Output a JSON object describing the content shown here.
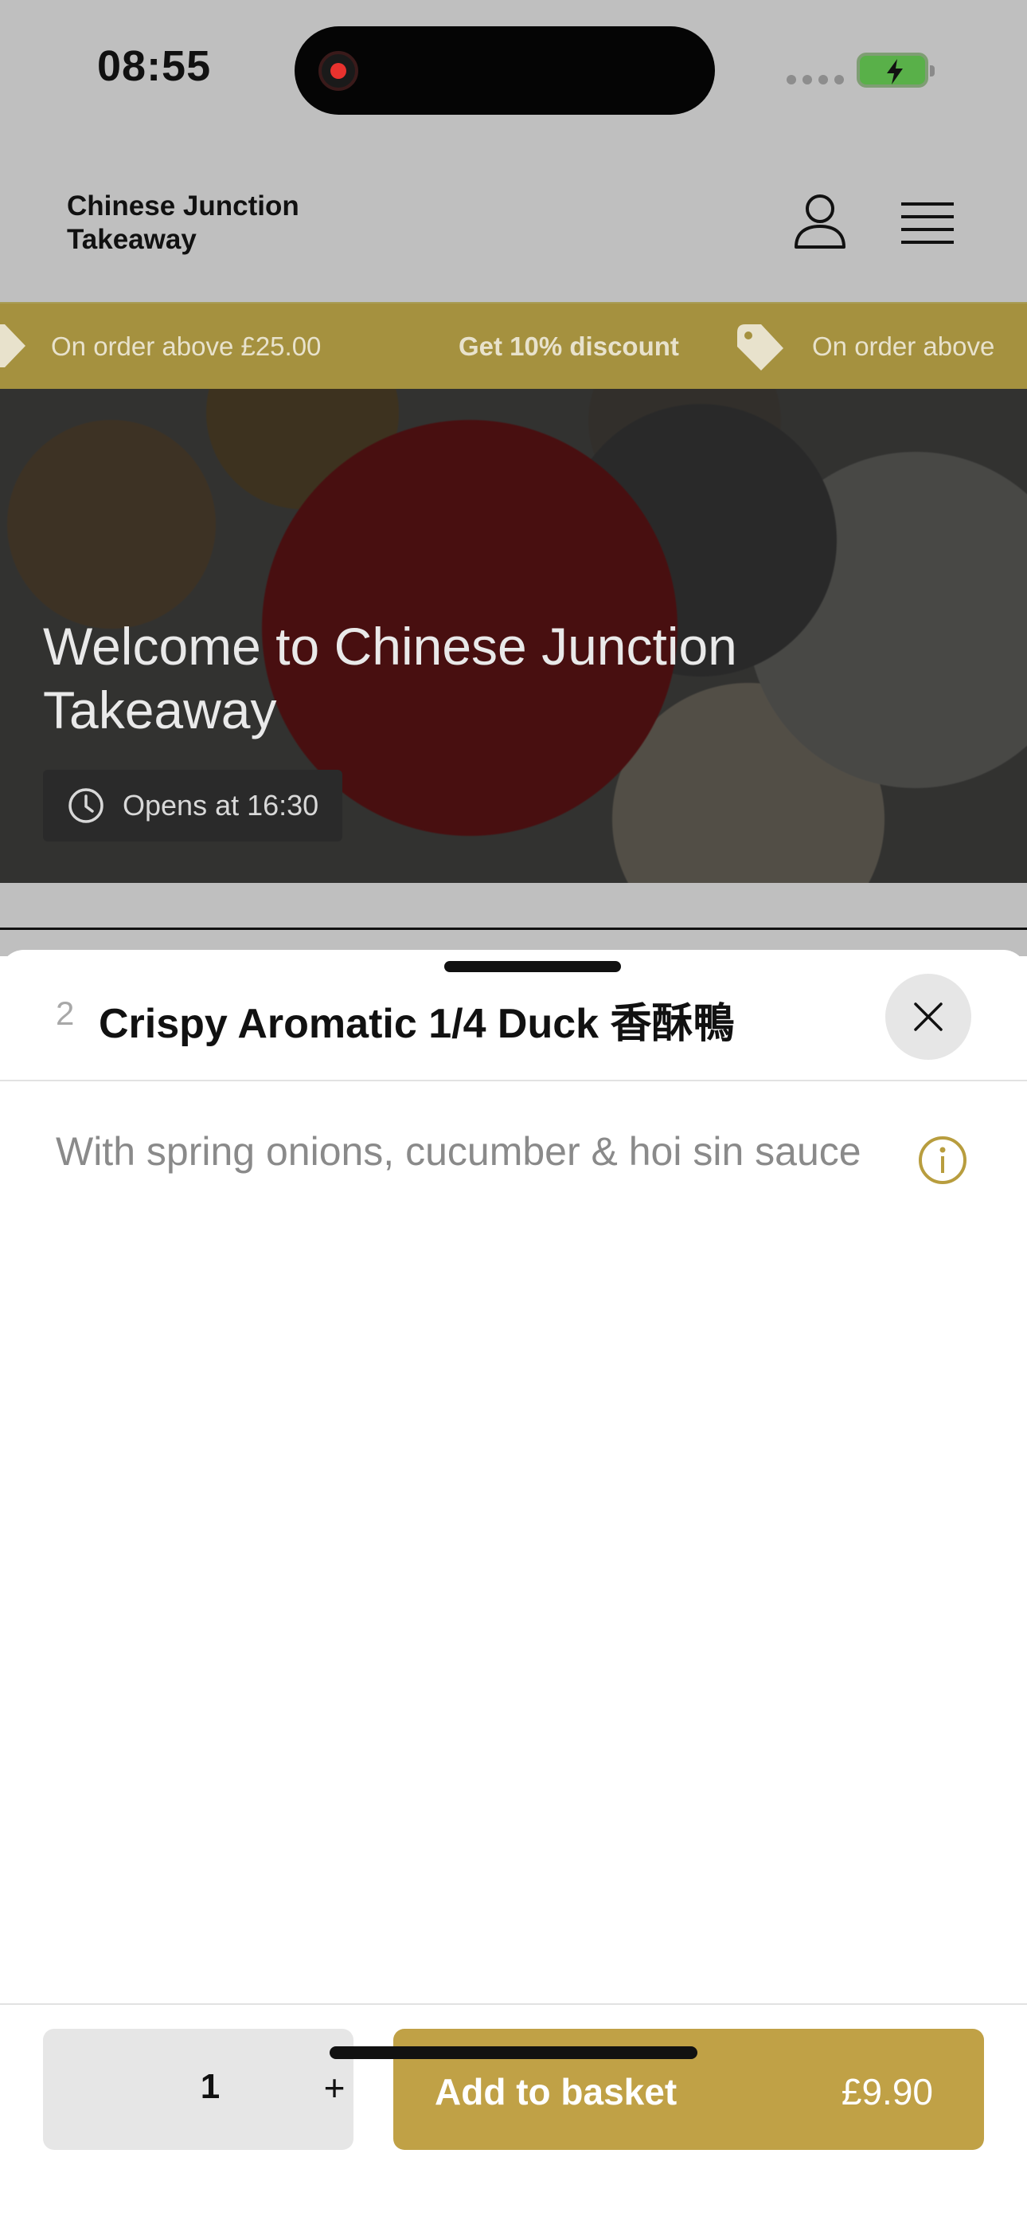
{
  "status_bar": {
    "time": "08:55",
    "recording_icon": "screen-recording-icon",
    "signal_icon": "cellular-signal-icon",
    "battery_icon": "battery-charging-icon",
    "battery_color": "#59b049"
  },
  "header": {
    "brand": "Chinese Junction Takeaway",
    "account_icon": "user-icon",
    "menu_icon": "hamburger-menu-icon",
    "accent_color": "#a89c55"
  },
  "promo_strip": {
    "items": [
      "On order above £25.00",
      "Get 10% discount",
      "On order above"
    ],
    "tag_icon": "price-tag-icon",
    "background_color": "#a5913f"
  },
  "hero": {
    "title": "Welcome to Chinese Junction Takeaway",
    "hours": "Opens at 16:30",
    "clock_icon": "clock-icon"
  },
  "sheet": {
    "item_number": "2",
    "item_title": "Crispy Aromatic 1/4 Duck 香酥鴨",
    "close_icon": "close-icon",
    "description": "With spring onions, cucumber & hoi sin sauce",
    "info_icon": "info-icon",
    "info_icon_color": "#b89d3e"
  },
  "footer": {
    "quantity": "1",
    "plus": "+",
    "add_label": "Add to basket",
    "price": "£9.90",
    "button_color": "#c0a146"
  }
}
